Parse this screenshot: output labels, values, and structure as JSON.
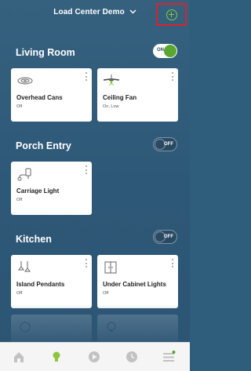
{
  "header": {
    "title": "Load Center Demo"
  },
  "colors": {
    "accent": "#8cc63f",
    "toggle_on": "#5aa631",
    "highlight": "#d9232e"
  },
  "rooms": [
    {
      "name": "Living Room",
      "toggle": "ON",
      "devices": [
        {
          "name": "Overhead Cans",
          "status": "Off",
          "icon": "can-light-icon"
        },
        {
          "name": "Ceiling Fan",
          "status": "On, Low",
          "icon": "ceiling-fan-icon"
        }
      ]
    },
    {
      "name": "Porch Entry",
      "toggle": "OFF",
      "devices": [
        {
          "name": "Carriage Light",
          "status": "Off",
          "icon": "carriage-light-icon"
        }
      ]
    },
    {
      "name": "Kitchen",
      "toggle": "OFF",
      "devices": [
        {
          "name": "Island Pendants",
          "status": "Off",
          "icon": "pendant-light-icon"
        },
        {
          "name": "Under Cabinet Lights",
          "status": "Off",
          "icon": "cabinet-light-icon"
        }
      ]
    }
  ],
  "nav": [
    "home-icon",
    "bulb-icon",
    "play-icon",
    "clock-icon",
    "menu-icon"
  ]
}
